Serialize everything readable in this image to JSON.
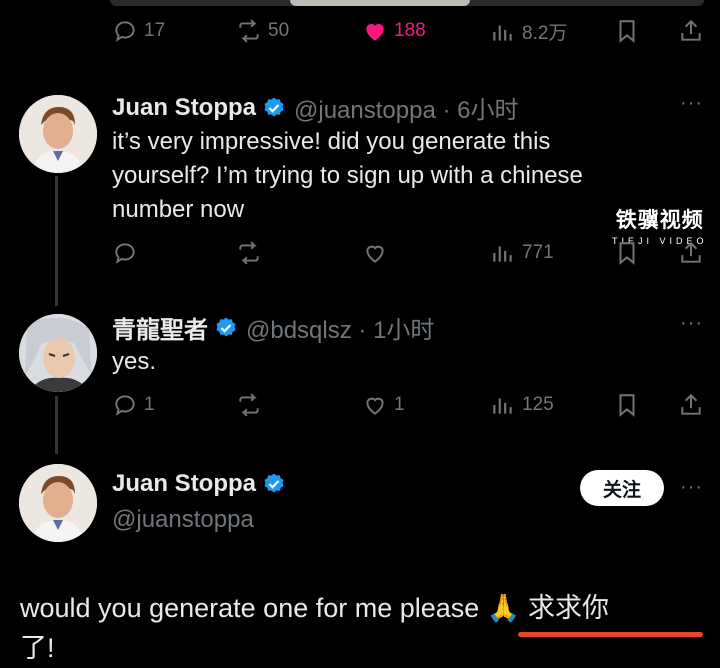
{
  "post1": {
    "replies": "17",
    "reposts": "50",
    "likes": "188",
    "views": "8.2万",
    "like_color": "#f91880"
  },
  "post2": {
    "name": "Juan Stoppa",
    "handle": "@juanstoppa · 6小时",
    "text_lines": [
      "it’s very impressive! did you generate this",
      "yourself? I’m trying to sign up with a chinese",
      "number now"
    ],
    "views": "771"
  },
  "watermark": {
    "cn": "铁骥视频",
    "en": "TIEJI VIDEO"
  },
  "post3": {
    "name": "青龍聖者",
    "handle": "@bdsqlsz · 1小时",
    "text": "yes.",
    "replies": "1",
    "likes": "1",
    "views": "125"
  },
  "post4": {
    "name": "Juan Stoppa",
    "handle": "@juanstoppa",
    "follow_label": "关注",
    "text_line1_a": "would you generate one for me please ",
    "emoji": "🙏",
    "text_line1_b": " 求求你",
    "text_line2": "了!"
  },
  "icons": {
    "more": "more-dots-icon",
    "verified_color": "#1d9bf0"
  }
}
